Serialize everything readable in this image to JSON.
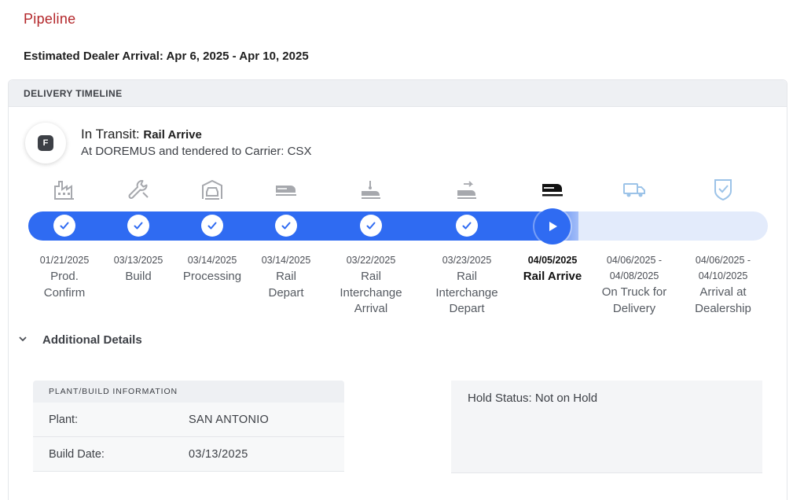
{
  "page": {
    "title": "Pipeline",
    "eta": "Estimated Dealer Arrival: Apr 6, 2025 - Apr 10, 2025"
  },
  "timeline": {
    "header": "DELIVERY TIMELINE",
    "status": {
      "badge": "F",
      "prefix": "In Transit:",
      "stage": "Rail Arrive",
      "description": "At DOREMUS and tendered to Carrier: CSX"
    },
    "progress": {
      "completed_steps": 6,
      "current_step": 7,
      "total_steps": 9
    },
    "steps": [
      {
        "date": "01/21/2025",
        "label_lines": [
          "Prod.",
          "Confirm"
        ],
        "icon": "factory-icon",
        "state": "done"
      },
      {
        "date": "03/13/2025",
        "label_lines": [
          "Build"
        ],
        "icon": "wrench-icon",
        "state": "done"
      },
      {
        "date": "03/14/2025",
        "label_lines": [
          "Processing"
        ],
        "icon": "car-garage-icon",
        "state": "done"
      },
      {
        "date": "03/14/2025",
        "label_lines": [
          "Rail",
          "Depart"
        ],
        "icon": "rail-car-icon",
        "state": "done"
      },
      {
        "date": "03/22/2025",
        "label_lines": [
          "Rail",
          "Interchange",
          "Arrival"
        ],
        "icon": "rail-interchange-arrival-icon",
        "state": "done"
      },
      {
        "date": "03/23/2025",
        "label_lines": [
          "Rail",
          "Interchange",
          "Depart"
        ],
        "icon": "rail-interchange-depart-icon",
        "state": "done"
      },
      {
        "date": "04/05/2025",
        "label_lines": [
          "Rail Arrive"
        ],
        "icon": "rail-arrive-icon",
        "state": "current"
      },
      {
        "date_lines": [
          "04/06/2025 -",
          "04/08/2025"
        ],
        "label_lines": [
          "On Truck for",
          "Delivery"
        ],
        "icon": "truck-icon",
        "state": "upcoming"
      },
      {
        "date_lines": [
          "04/06/2025 -",
          "04/10/2025"
        ],
        "label_lines": [
          "Arrival at",
          "Dealership"
        ],
        "icon": "shield-check-icon",
        "state": "upcoming"
      }
    ]
  },
  "additional": {
    "toggle_label": "Additional Details",
    "plant": {
      "header": "PLANT/BUILD INFORMATION",
      "rows": [
        {
          "key": "Plant:",
          "value": "SAN ANTONIO"
        },
        {
          "key": "Build Date:",
          "value": "03/13/2025"
        }
      ]
    },
    "hold": {
      "text": "Hold Status: Not on Hold"
    }
  },
  "colors": {
    "title": "#b3262a",
    "accent": "#2f6bf2",
    "track_rest": "#e3ebfb",
    "icon_done": "#a6a8ad",
    "icon_upcoming": "#9cc3e8",
    "icon_current": "#111111"
  }
}
